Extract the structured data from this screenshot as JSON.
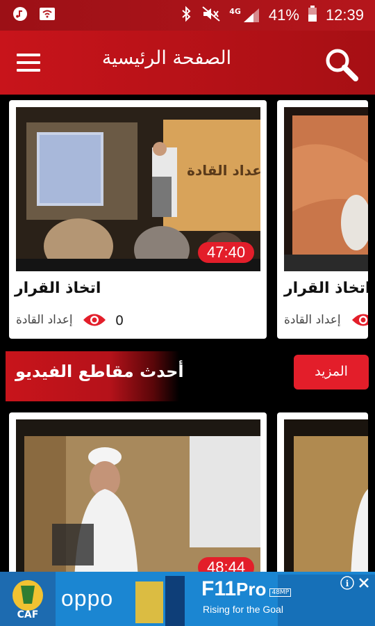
{
  "status_bar": {
    "network": "4G",
    "battery": "41%",
    "time": "12:39"
  },
  "app_bar": {
    "title": "الصفحة الرئيسية"
  },
  "top_cards": [
    {
      "title": "اتخاذ القرار",
      "category": "إعداد القادة",
      "views": "0",
      "duration": "47:40",
      "thumb_banner": "عداد القادة"
    },
    {
      "title": "اتخاذ القرار",
      "category": "إعداد القادة"
    }
  ],
  "section": {
    "title": "أحدث مقاطع الفيديو",
    "more_label": "المزيد"
  },
  "latest_cards": [
    {
      "duration": "48:44"
    },
    {}
  ],
  "ad": {
    "brand": "oppo",
    "product": "F11",
    "product_suffix": "Pro",
    "product_badge": "48MP",
    "tagline": "Rising for the Goal"
  },
  "colors": {
    "primary": "#c8141b",
    "accent": "#e31e2a",
    "background": "#000000"
  }
}
